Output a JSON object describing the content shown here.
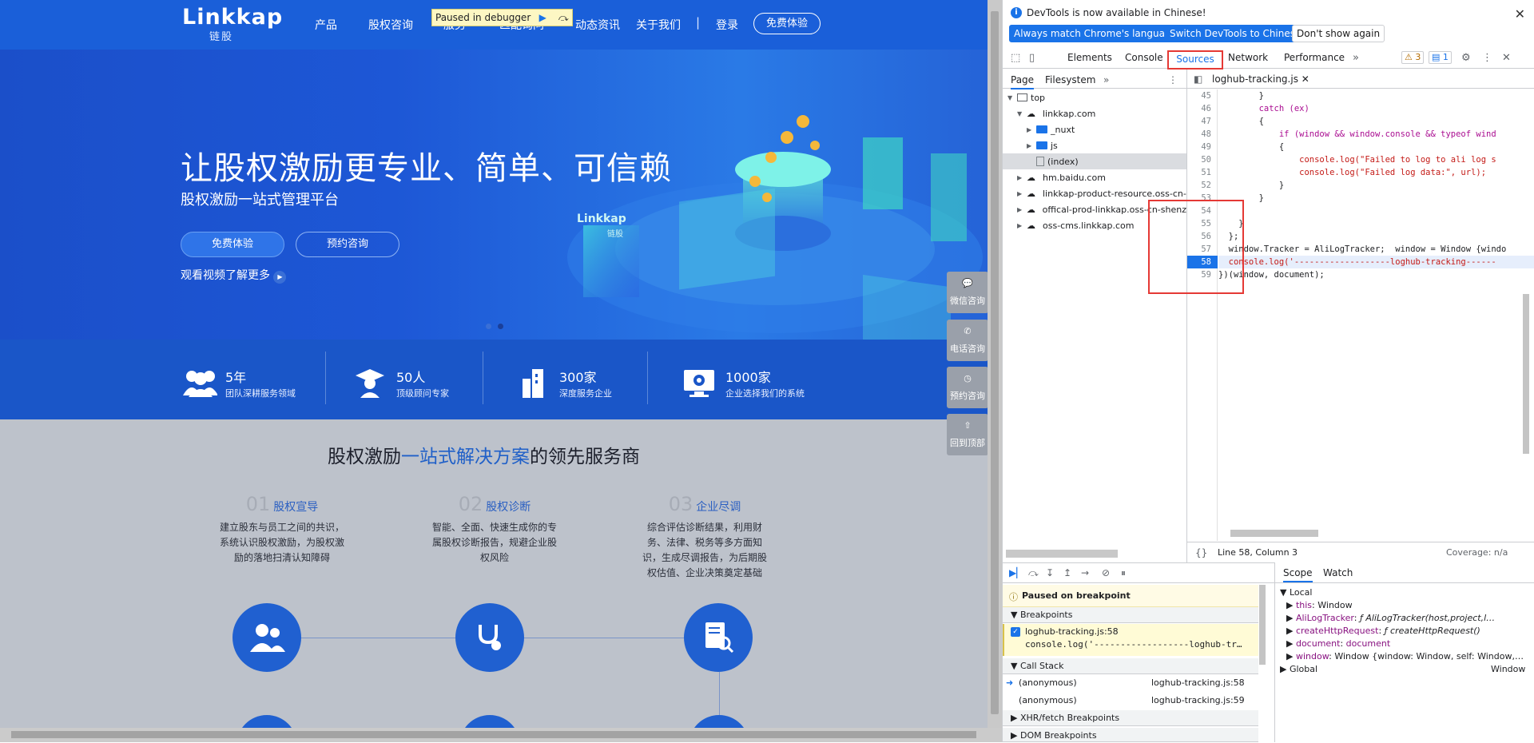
{
  "site": {
    "logo": "Linkkap",
    "logo_sub": "链股",
    "nav": [
      "产品",
      "股权咨询",
      "服务",
      "匹配询问",
      "动态资讯",
      "关于我们",
      "|",
      "登录"
    ],
    "nav_try": "免费体验",
    "paused_label": "Paused in debugger",
    "hero": {
      "title": "让股权激励更专业、简单、可信赖",
      "subtitle": "股权激励一站式管理平台",
      "btn_try": "免费体验",
      "btn_consult": "预约咨询",
      "video_link": "观看视频了解更多",
      "platform_label": "Linkkap",
      "platform_sub": "链股"
    },
    "stats": [
      {
        "num": "5年",
        "desc": "团队深耕服务领域"
      },
      {
        "num": "50人",
        "desc": "顶级顾问专家"
      },
      {
        "num": "300家",
        "desc": "深度服务企业"
      },
      {
        "num": "1000家",
        "desc": "企业选择我们的系统"
      }
    ],
    "section": {
      "title_pre": "股权激励",
      "title_hl": "一站式解决方案",
      "title_post": "的领先服务商",
      "steps": [
        {
          "num": "01",
          "label": "股权宣导",
          "text": "建立股东与员工之间的共识，系统认识股权激励，为股权激励的落地扫清认知障碍"
        },
        {
          "num": "02",
          "label": "股权诊断",
          "text": "智能、全面、快速生成你的专属股权诊断报告，规避企业股权风险"
        },
        {
          "num": "03",
          "label": "企业尽调",
          "text": "综合评估诊断结果，利用财务、法律、税务等多方面知识，生成尽调报告，为后期股权估值、企业决策奠定基础"
        }
      ]
    },
    "float": [
      "微信咨询",
      "电话咨询",
      "预约咨询",
      "回到顶部"
    ]
  },
  "devtools": {
    "info_text": "DevTools is now available in Chinese!",
    "btn_match": "Always match Chrome's language",
    "btn_switch": "Switch DevTools to Chinese",
    "btn_dont": "Don't show again",
    "tabs": [
      "Elements",
      "Console",
      "Sources",
      "Network",
      "Performance"
    ],
    "active_tab": "Sources",
    "warn_count": "3",
    "msg_count": "1",
    "nav_tabs": [
      "Page",
      "Filesystem"
    ],
    "tree": [
      {
        "label": "top",
        "depth": 0
      },
      {
        "label": "linkkap.com",
        "depth": 1
      },
      {
        "label": "_nuxt",
        "depth": 2
      },
      {
        "label": "js",
        "depth": 2
      },
      {
        "label": "(index)",
        "depth": 2
      },
      {
        "label": "hm.baidu.com",
        "depth": 1
      },
      {
        "label": "linkkap-product-resource.oss-cn-",
        "depth": 1
      },
      {
        "label": "offical-prod-linkkap.oss-cn-shenz",
        "depth": 1
      },
      {
        "label": "oss-cms.linkkap.com",
        "depth": 1
      }
    ],
    "file_tab": "loghub-tracking.js",
    "code_lines": [
      {
        "n": "45",
        "text": "        }"
      },
      {
        "n": "46",
        "text": "        catch (ex)"
      },
      {
        "n": "47",
        "text": "        {"
      },
      {
        "n": "48",
        "text": "            if (window && window.console && typeof wind"
      },
      {
        "n": "49",
        "text": "            {"
      },
      {
        "n": "50",
        "text": "                console.log(\"Failed to log to ali log s"
      },
      {
        "n": "51",
        "text": "                console.log(\"Failed log data:\", url);"
      },
      {
        "n": "52",
        "text": "            }"
      },
      {
        "n": "53",
        "text": "        }"
      },
      {
        "n": "54",
        "text": ""
      },
      {
        "n": "55",
        "text": "    }"
      },
      {
        "n": "56",
        "text": "  };"
      },
      {
        "n": "57",
        "text": "  window.Tracker = AliLogTracker;  window = Window {windo"
      },
      {
        "n": "58",
        "text": "  console.log('-------------------loghub-tracking------"
      },
      {
        "n": "59",
        "text": "})(window, document);"
      }
    ],
    "status_text": "Line 58, Column 3",
    "coverage": "Coverage: n/a",
    "paused_text": "Paused on breakpoint",
    "sections": [
      "Breakpoints",
      "Call Stack",
      "XHR/fetch Breakpoints",
      "DOM Breakpoints"
    ],
    "breakpoint_file": "loghub-tracking.js:58",
    "breakpoint_code": "console.log('------------------loghub-tr…",
    "call_stack": [
      {
        "fn": "(anonymous)",
        "loc": "loghub-tracking.js:58"
      },
      {
        "fn": "(anonymous)",
        "loc": "loghub-tracking.js:59"
      }
    ],
    "scope_tabs": [
      "Scope",
      "Watch"
    ],
    "scope": [
      {
        "k": "Local",
        "v": ""
      },
      {
        "k": "this",
        "v": "Window"
      },
      {
        "k": "AliLogTracker",
        "v": "ƒ AliLogTracker(host,project,l…"
      },
      {
        "k": "createHttpRequest",
        "v": "ƒ createHttpRequest()"
      },
      {
        "k": "document",
        "v": "document"
      },
      {
        "k": "window",
        "v": "Window {window: Window, self: Window,…"
      },
      {
        "k": "Global",
        "v": "Window"
      }
    ]
  }
}
